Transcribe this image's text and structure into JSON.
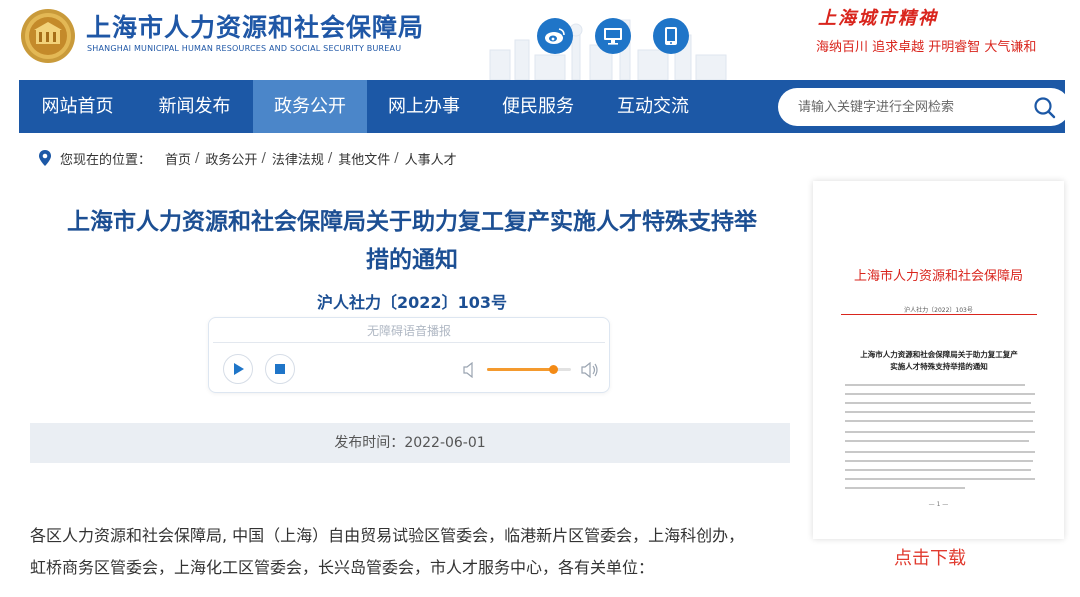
{
  "header": {
    "title": "上海市人力资源和社会保障局",
    "subtitle": "SHANGHAI MUNICIPAL HUMAN RESOURCES AND SOCIAL SECURITY BUREAU",
    "icons": [
      "weibo-icon",
      "desktop-icon",
      "mobile-icon"
    ],
    "slogan_title": "上海城市精神",
    "slogan_line": "海纳百川  追求卓越  开明睿智  大气谦和"
  },
  "nav": {
    "items": [
      {
        "label": "网站首页"
      },
      {
        "label": "新闻发布"
      },
      {
        "label": "政务公开"
      },
      {
        "label": "网上办事"
      },
      {
        "label": "便民服务"
      },
      {
        "label": "互动交流"
      }
    ],
    "active": "政务公开",
    "search_placeholder": "请输入关键字进行全网检索"
  },
  "breadcrumb": {
    "prefix": "您现在的位置：",
    "items": [
      "首页",
      "政务公开",
      "法律法规",
      "其他文件",
      "人事人才"
    ]
  },
  "article": {
    "title_line1": "上海市人力资源和社会保障局关于助力复工复产实施人才特殊支持举",
    "title_line2": "措的通知",
    "doc_number": "沪人社力〔2022〕103号",
    "player_title": "无障碍语音播报",
    "volume_level": 0.78,
    "publish_label": "发布时间：",
    "publish_date": "2022-06-01",
    "body_line1": "各区人力资源和社会保障局, 中国（上海）自由贸易试验区管委会，临港新片区管委会，上海科创办，",
    "body_line2": "虹桥商务区管委会，上海化工区管委会，长兴岛管委会，市人才服务中心，各有关单位："
  },
  "preview": {
    "head": "上海市人力资源和社会保障局",
    "number": "沪人社力〔2022〕103号",
    "title_line1": "上海市人力资源和社会保障局关于助力复工复产",
    "title_line2": "实施人才特殊支持举措的通知",
    "page": "— 1 —"
  },
  "download_label": "点击下载",
  "colors": {
    "brand_blue": "#1c58a6",
    "nav_active": "#4b86c9",
    "title_blue": "#1c4f93",
    "accent_red": "#d9251d",
    "volume_orange": "#f38a15"
  }
}
